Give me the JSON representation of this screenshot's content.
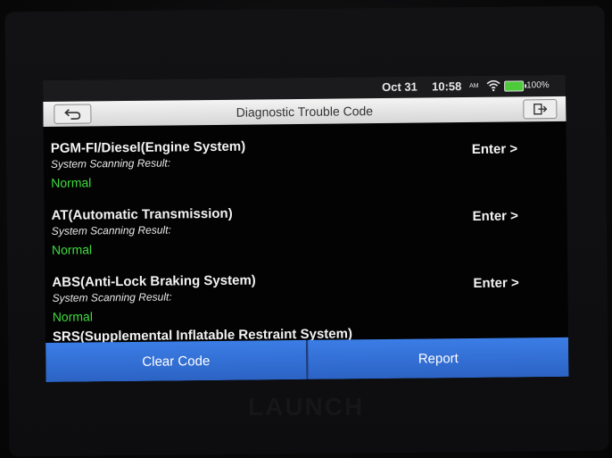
{
  "status_bar": {
    "date": "Oct 31",
    "time": "10:58",
    "ampm": "AM",
    "battery": "100%",
    "icons": [
      "wifi-icon",
      "battery-icon"
    ]
  },
  "header": {
    "title": "Diagnostic Trouble Code",
    "back_icon": "back-arrow-icon",
    "exit_icon": "exit-icon"
  },
  "systems": [
    {
      "name": "PGM-FI/Diesel(Engine System)",
      "result_label": "System Scanning Result:",
      "status": "Normal",
      "action": "Enter >"
    },
    {
      "name": "AT(Automatic Transmission)",
      "result_label": "System Scanning Result:",
      "status": "Normal",
      "action": "Enter >"
    },
    {
      "name": "ABS(Anti-Lock Braking System)",
      "result_label": "System Scanning Result:",
      "status": "Normal",
      "action": "Enter >"
    }
  ],
  "partial_row": {
    "name": "SRS(Supplemental Inflatable Restraint System)"
  },
  "footer": {
    "clear_code": "Clear Code",
    "report": "Report"
  },
  "bezel": {
    "brand": "LAUNCH"
  },
  "colors": {
    "accent_blue": "#2c63c4",
    "status_green": "#3fdc3f",
    "screen_bg": "#030303"
  }
}
